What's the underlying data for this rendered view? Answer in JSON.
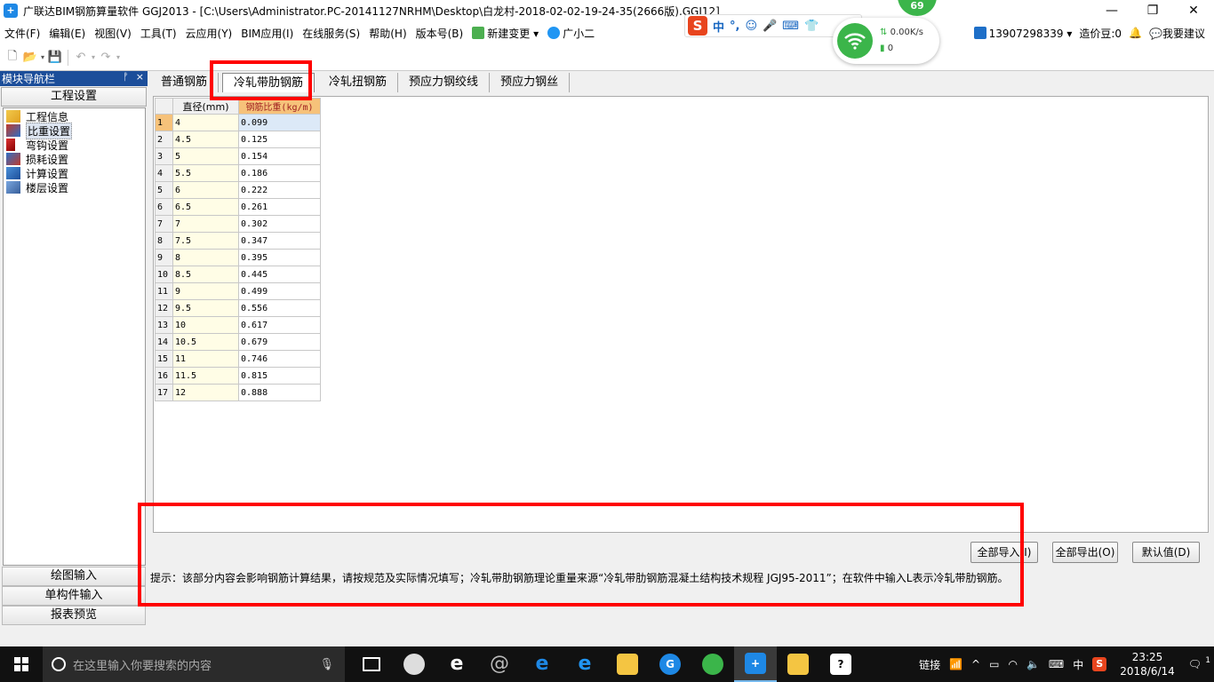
{
  "window": {
    "title": "广联达BIM钢筋算量软件 GGJ2013 - [C:\\Users\\Administrator.PC-20141127NRHM\\Desktop\\白龙村-2018-02-02-19-24-35(2666版).GGJ12]",
    "minimize": "—",
    "restore": "❐",
    "close": "✕"
  },
  "menu": {
    "items": [
      "文件(F)",
      "编辑(E)",
      "视图(V)",
      "工具(T)",
      "云应用(Y)",
      "BIM应用(I)",
      "在线服务(S)",
      "帮助(H)",
      "版本号(B)",
      "新建变更",
      "广小二"
    ],
    "account": "13907298339",
    "coins": "造价豆:0",
    "suggest": "我要建议"
  },
  "ime": {
    "lang": "中",
    "punct": "°,",
    "emoji": "☺"
  },
  "network": {
    "speed": "0.00K/s",
    "count": "0",
    "badge": "69"
  },
  "nav": {
    "header": "模块导航栏",
    "pin": "ᚡ",
    "close": "×",
    "section": "工程设置",
    "tree": [
      "工程信息",
      "比重设置",
      "弯钩设置",
      "损耗设置",
      "计算设置",
      "楼层设置"
    ],
    "selected_index": 1,
    "bottom": [
      "绘图输入",
      "单构件输入",
      "报表预览"
    ]
  },
  "tabs": [
    "普通钢筋",
    "冷轧带肋钢筋",
    "冷轧扭钢筋",
    "预应力钢绞线",
    "预应力钢丝"
  ],
  "active_tab": 1,
  "table": {
    "headers": [
      "直径(mm)",
      "钢筋比重(kg/m)"
    ],
    "rows": [
      [
        "1",
        "4",
        "0.099"
      ],
      [
        "2",
        "4.5",
        "0.125"
      ],
      [
        "3",
        "5",
        "0.154"
      ],
      [
        "4",
        "5.5",
        "0.186"
      ],
      [
        "5",
        "6",
        "0.222"
      ],
      [
        "6",
        "6.5",
        "0.261"
      ],
      [
        "7",
        "7",
        "0.302"
      ],
      [
        "8",
        "7.5",
        "0.347"
      ],
      [
        "9",
        "8",
        "0.395"
      ],
      [
        "10",
        "8.5",
        "0.445"
      ],
      [
        "11",
        "9",
        "0.499"
      ],
      [
        "12",
        "9.5",
        "0.556"
      ],
      [
        "13",
        "10",
        "0.617"
      ],
      [
        "14",
        "10.5",
        "0.679"
      ],
      [
        "15",
        "11",
        "0.746"
      ],
      [
        "16",
        "11.5",
        "0.815"
      ],
      [
        "17",
        "12",
        "0.888"
      ]
    ]
  },
  "buttons": {
    "import_all": "全部导入(I)",
    "export_all": "全部导出(O)",
    "default": "默认值(D)"
  },
  "hint": "提示：该部分内容会影响钢筋计算结果，请按规范及实际情况填写；冷轧带肋钢筋理论重量来源“冷轧带肋钢筋混凝土结构技术规程 JGJ95-2011”；在软件中输入L表示冷轧带肋钢筋。",
  "taskbar": {
    "search_placeholder": "在这里输入你要搜索的内容",
    "tray_link": "链接",
    "tray_lang": "中",
    "time": "23:25",
    "date": "2018/6/14",
    "notify_count": "1"
  },
  "colors": {
    "accent": "#1c4e9a",
    "highlight": "#ff0000",
    "header_orange": "#f6c27a"
  }
}
